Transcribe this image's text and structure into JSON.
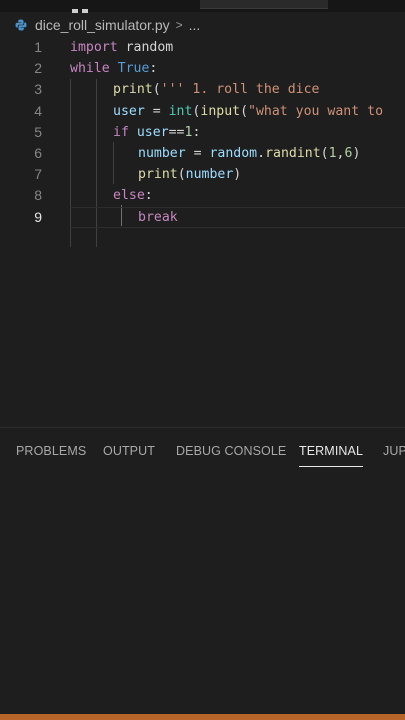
{
  "breadcrumb": {
    "file": "dice_roll_simulator.py",
    "separator": ">",
    "more": "..."
  },
  "editor": {
    "active_line": 9,
    "lines": [
      {
        "num": "1",
        "tokens": [
          [
            "k1",
            "import"
          ],
          [
            "pl",
            " "
          ],
          [
            "pl",
            "random"
          ]
        ]
      },
      {
        "num": "2",
        "tokens": [
          [
            "k1",
            "while"
          ],
          [
            "pl",
            " "
          ],
          [
            "k2",
            "True"
          ],
          [
            "pl",
            ":"
          ]
        ]
      },
      {
        "num": "3",
        "tokens": [
          [
            "fn",
            "print"
          ],
          [
            "pl",
            "("
          ],
          [
            "st",
            "''' 1. roll the dice"
          ]
        ]
      },
      {
        "num": "4",
        "tokens": [
          [
            "va",
            "user"
          ],
          [
            "pl",
            " = "
          ],
          [
            "ty",
            "int"
          ],
          [
            "pl",
            "("
          ],
          [
            "fn",
            "input"
          ],
          [
            "pl",
            "("
          ],
          [
            "st",
            "\"what you want to"
          ]
        ]
      },
      {
        "num": "5",
        "tokens": [
          [
            "k1",
            "if"
          ],
          [
            "pl",
            " "
          ],
          [
            "va",
            "user"
          ],
          [
            "pl",
            "=="
          ],
          [
            "nu",
            "1"
          ],
          [
            "pl",
            ":"
          ]
        ]
      },
      {
        "num": "6",
        "tokens": [
          [
            "va",
            "number"
          ],
          [
            "pl",
            " = "
          ],
          [
            "va",
            "random"
          ],
          [
            "pl",
            "."
          ],
          [
            "fn",
            "randint"
          ],
          [
            "pl",
            "("
          ],
          [
            "nu",
            "1"
          ],
          [
            "pl",
            ","
          ],
          [
            "nu",
            "6"
          ],
          [
            "pl",
            ")"
          ]
        ]
      },
      {
        "num": "7",
        "tokens": [
          [
            "fn",
            "print"
          ],
          [
            "pl",
            "("
          ],
          [
            "va",
            "number"
          ],
          [
            "pl",
            ")"
          ]
        ]
      },
      {
        "num": "8",
        "tokens": [
          [
            "k1",
            "else"
          ],
          [
            "pl",
            ":"
          ]
        ]
      },
      {
        "num": "9",
        "tokens": [
          [
            "k1",
            "break"
          ]
        ]
      }
    ]
  },
  "panel": {
    "tabs": [
      "PROBLEMS",
      "OUTPUT",
      "DEBUG CONSOLE",
      "TERMINAL",
      "JUP"
    ],
    "active_tab": "TERMINAL"
  },
  "colors": {
    "keyword": "#c586c0",
    "constant": "#569cd6",
    "function": "#dcdcaa",
    "string": "#ce9178",
    "number": "#b5cea8",
    "variable": "#9cdcfe",
    "type": "#4ec9b0",
    "status_bar": "#b8652a"
  }
}
